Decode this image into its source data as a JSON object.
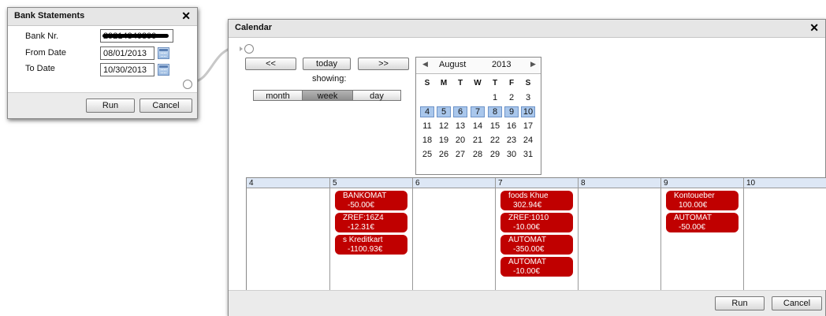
{
  "bank_statements": {
    "title": "Bank Statements",
    "bank_nr_label": "Bank Nr.",
    "bank_nr_value": "29214340800",
    "from_date_label": "From Date",
    "from_date_value": "08/01/2013",
    "to_date_label": "To Date",
    "to_date_value": "10/30/2013",
    "run_label": "Run",
    "cancel_label": "Cancel"
  },
  "calendar": {
    "title": "Calendar",
    "prev_label": "<<",
    "today_label": "today",
    "next_label": ">>",
    "showing_label": "showing:",
    "views": [
      "month",
      "week",
      "day"
    ],
    "active_view": "week",
    "run_label": "Run",
    "cancel_label": "Cancel",
    "mini": {
      "month": "August",
      "year": "2013",
      "dow": [
        "S",
        "M",
        "T",
        "W",
        "T",
        "F",
        "S"
      ],
      "weeks": [
        [
          "",
          "",
          "",
          "",
          "1",
          "2",
          "3"
        ],
        [
          "4",
          "5",
          "6",
          "7",
          "8",
          "9",
          "10"
        ],
        [
          "11",
          "12",
          "13",
          "14",
          "15",
          "16",
          "17"
        ],
        [
          "18",
          "19",
          "20",
          "21",
          "22",
          "23",
          "24"
        ],
        [
          "25",
          "26",
          "27",
          "28",
          "29",
          "30",
          "31"
        ]
      ],
      "selected_week": 1
    },
    "week": {
      "days": [
        "4",
        "5",
        "6",
        "7",
        "8",
        "9",
        "10"
      ],
      "events": [
        {
          "day": 1,
          "line1": "BANKOMAT",
          "line2": "-50.00€"
        },
        {
          "day": 1,
          "line1": "ZREF:16Z4",
          "line2": "-12.31€"
        },
        {
          "day": 1,
          "line1": "s Kreditkart",
          "line2": "-1100.93€"
        },
        {
          "day": 3,
          "line1": "foods Khue",
          "line2": "302.94€"
        },
        {
          "day": 3,
          "line1": "ZREF:1010",
          "line2": "-10.00€"
        },
        {
          "day": 3,
          "line1": "AUTOMAT",
          "line2": "-350.00€"
        },
        {
          "day": 3,
          "line1": "AUTOMAT",
          "line2": "-10.00€"
        },
        {
          "day": 5,
          "line1": "Kontoueber",
          "line2": "100.00€"
        },
        {
          "day": 5,
          "line1": "AUTOMAT",
          "line2": "-50.00€"
        }
      ]
    }
  }
}
